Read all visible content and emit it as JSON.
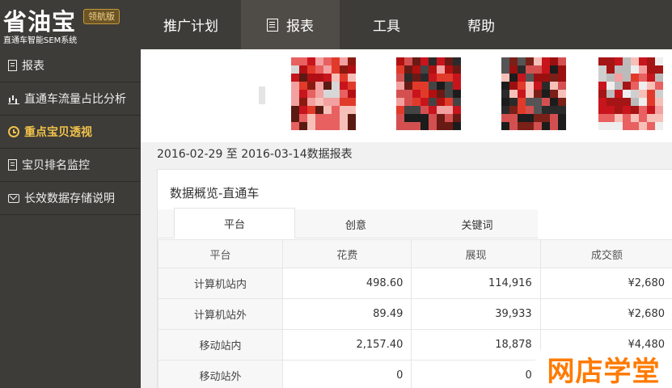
{
  "header": {
    "logo_title": "省油宝",
    "logo_badge": "领航版",
    "logo_subtitle": "直通车智能SEM系统",
    "nav": [
      {
        "label": "推广计划"
      },
      {
        "label": "报表",
        "icon": "document-icon",
        "active": true
      },
      {
        "label": "工具"
      },
      {
        "label": "帮助"
      }
    ]
  },
  "sidebar": {
    "items": [
      {
        "label": "报表",
        "icon": "document-icon"
      },
      {
        "label": "直通车流量占比分析",
        "icon": "bar-chart-icon"
      },
      {
        "label": "重点宝贝透视",
        "icon": "clock-icon",
        "active": true
      },
      {
        "label": "宝贝排名监控",
        "icon": "document-icon"
      },
      {
        "label": "长效数据存储说明",
        "icon": "mail-icon"
      }
    ]
  },
  "content": {
    "date_range": "2016-02-29 至 2016-03-14数据报表",
    "panel_title": "数据概览-直通车",
    "tabs": [
      {
        "label": "平台",
        "active": true
      },
      {
        "label": "创意"
      },
      {
        "label": "关键词"
      }
    ],
    "table": {
      "headers": [
        "平台",
        "花费",
        "展现",
        "成交额"
      ],
      "rows": [
        [
          "计算机站内",
          "498.60",
          "114,916",
          "¥2,680"
        ],
        [
          "计算机站外",
          "89.49",
          "39,933",
          "¥2,680"
        ],
        [
          "移动站内",
          "2,157.40",
          "18,878",
          "¥4,480"
        ],
        [
          "移动站外",
          "0",
          "0",
          ""
        ]
      ]
    }
  },
  "watermark": "网店学堂",
  "colors": {
    "header_bg": "#3e3c38",
    "active_sidebar": "#f0c24b",
    "watermark": "#ff7a00"
  }
}
